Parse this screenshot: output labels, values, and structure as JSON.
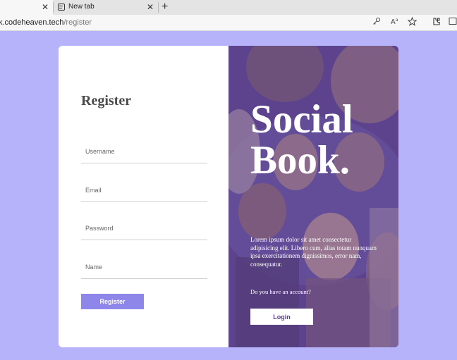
{
  "browser": {
    "tabs": [
      {
        "title": "",
        "close_glyph": "✕"
      },
      {
        "title": "New tab",
        "close_glyph": "✕"
      }
    ],
    "new_tab_glyph": "+",
    "address": {
      "host": "k.codeheaven.tech",
      "path": "/register"
    },
    "icons": [
      "key-icon",
      "read-aloud-icon",
      "favorite-star-icon",
      "extensions-icon",
      "split-screen-icon"
    ]
  },
  "register_form": {
    "title": "Register",
    "fields": [
      {
        "placeholder": "Username"
      },
      {
        "placeholder": "Email"
      },
      {
        "placeholder": "Password"
      },
      {
        "placeholder": "Name"
      }
    ],
    "submit_label": "Register"
  },
  "promo": {
    "brand_line1": "Social",
    "brand_line2": "Book.",
    "description": "Lorem ipsum dolor sit amet consectetur adipisicing elit. Libero cum, alias totam nunquam ipsa exercitationem dignissimos, error nam, consequatur.",
    "question": "Do you have an account?",
    "login_label": "Login"
  },
  "colors": {
    "page_background": "#b7b3fb",
    "register_button": "#8f86ea",
    "login_text": "#5a3f8f",
    "photo_overlay": "#46288c"
  }
}
